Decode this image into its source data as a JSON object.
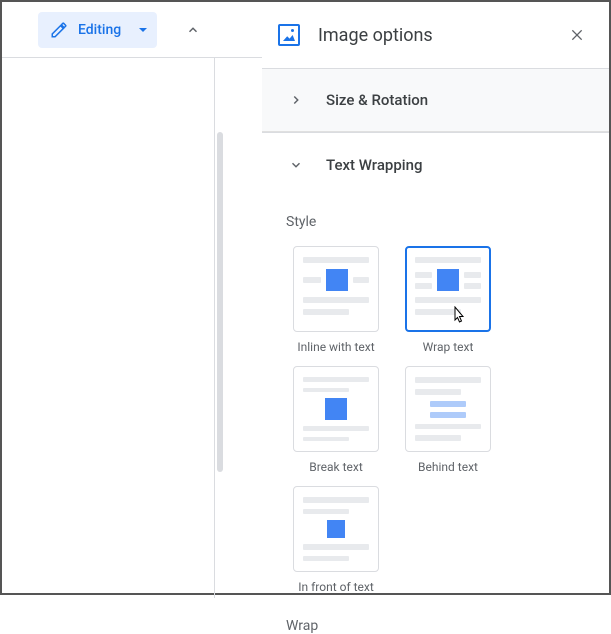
{
  "toolbar": {
    "editing_label": "Editing"
  },
  "panel": {
    "title": "Image options",
    "sections": {
      "size_rotation": "Size & Rotation",
      "text_wrapping": "Text Wrapping"
    },
    "style_label": "Style",
    "wrap_label": "Wrap",
    "options": {
      "inline": "Inline with text",
      "wrap": "Wrap text",
      "break": "Break text",
      "behind": "Behind text",
      "front": "In front of text"
    }
  }
}
